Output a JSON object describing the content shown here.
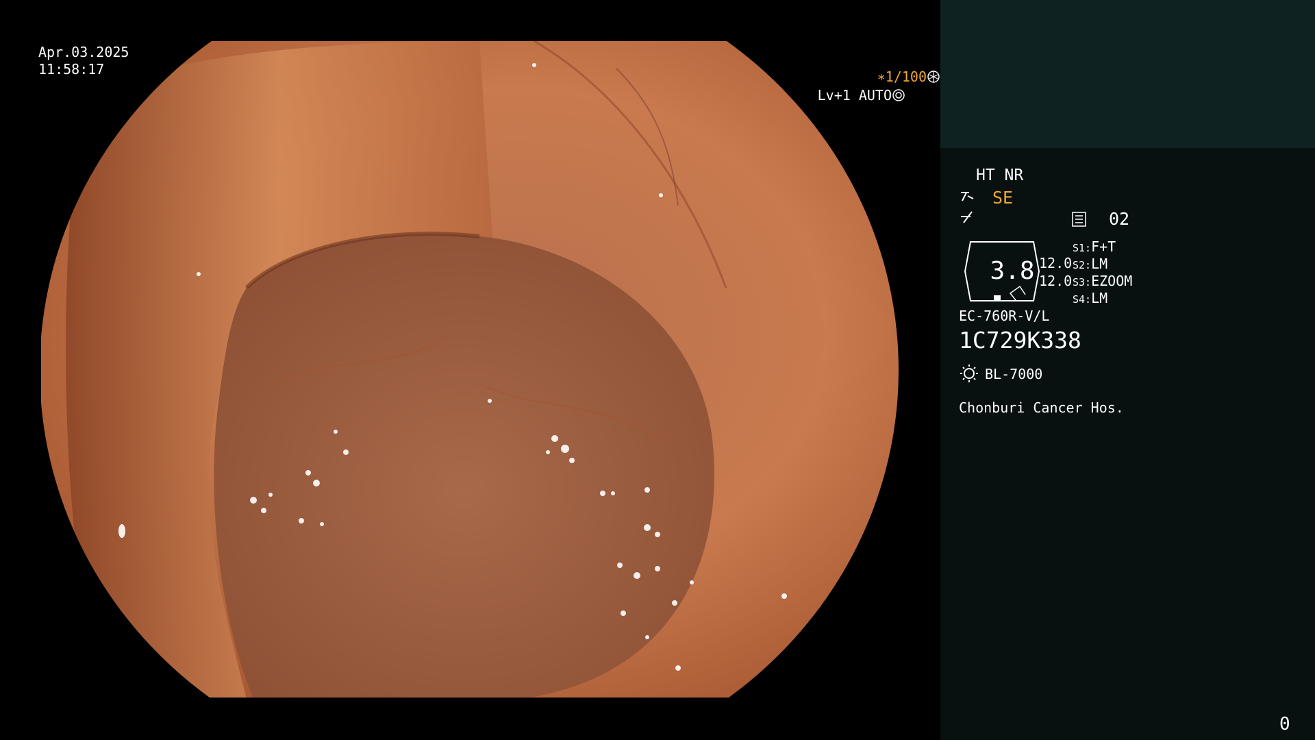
{
  "osd": {
    "date": "Apr.03.2025",
    "time": "11:58:17",
    "shutter": "∗1/100",
    "level": "Lv+1 AUTO"
  },
  "panel": {
    "ht_nr": "HT NR",
    "se": "SE",
    "freeze_number": "02",
    "zoom": "3.8",
    "level_a": "12.0",
    "level_b": "12.0",
    "switches": [
      {
        "key": "S1:",
        "value": "F+T"
      },
      {
        "key": "S2:",
        "value": "LM"
      },
      {
        "key": "S3:",
        "value": "EZOOM"
      },
      {
        "key": "S4:",
        "value": "LM"
      }
    ],
    "scope_model": "EC-760R-V/L",
    "serial": "1C729K338",
    "light_source": "BL-7000",
    "hospital": "Chonburi Cancer Hos.",
    "counter": "0"
  },
  "icons": {
    "shutter": "aperture-icon",
    "level": "iris-icon",
    "structure": "structure-enhance-icon",
    "freeze": "freeze-icon",
    "memory": "memory-card-icon",
    "light": "sun-icon"
  },
  "colors": {
    "accent": "#f0a830",
    "panel_bg": "#081010",
    "thumb_bg": "#0e2222"
  }
}
